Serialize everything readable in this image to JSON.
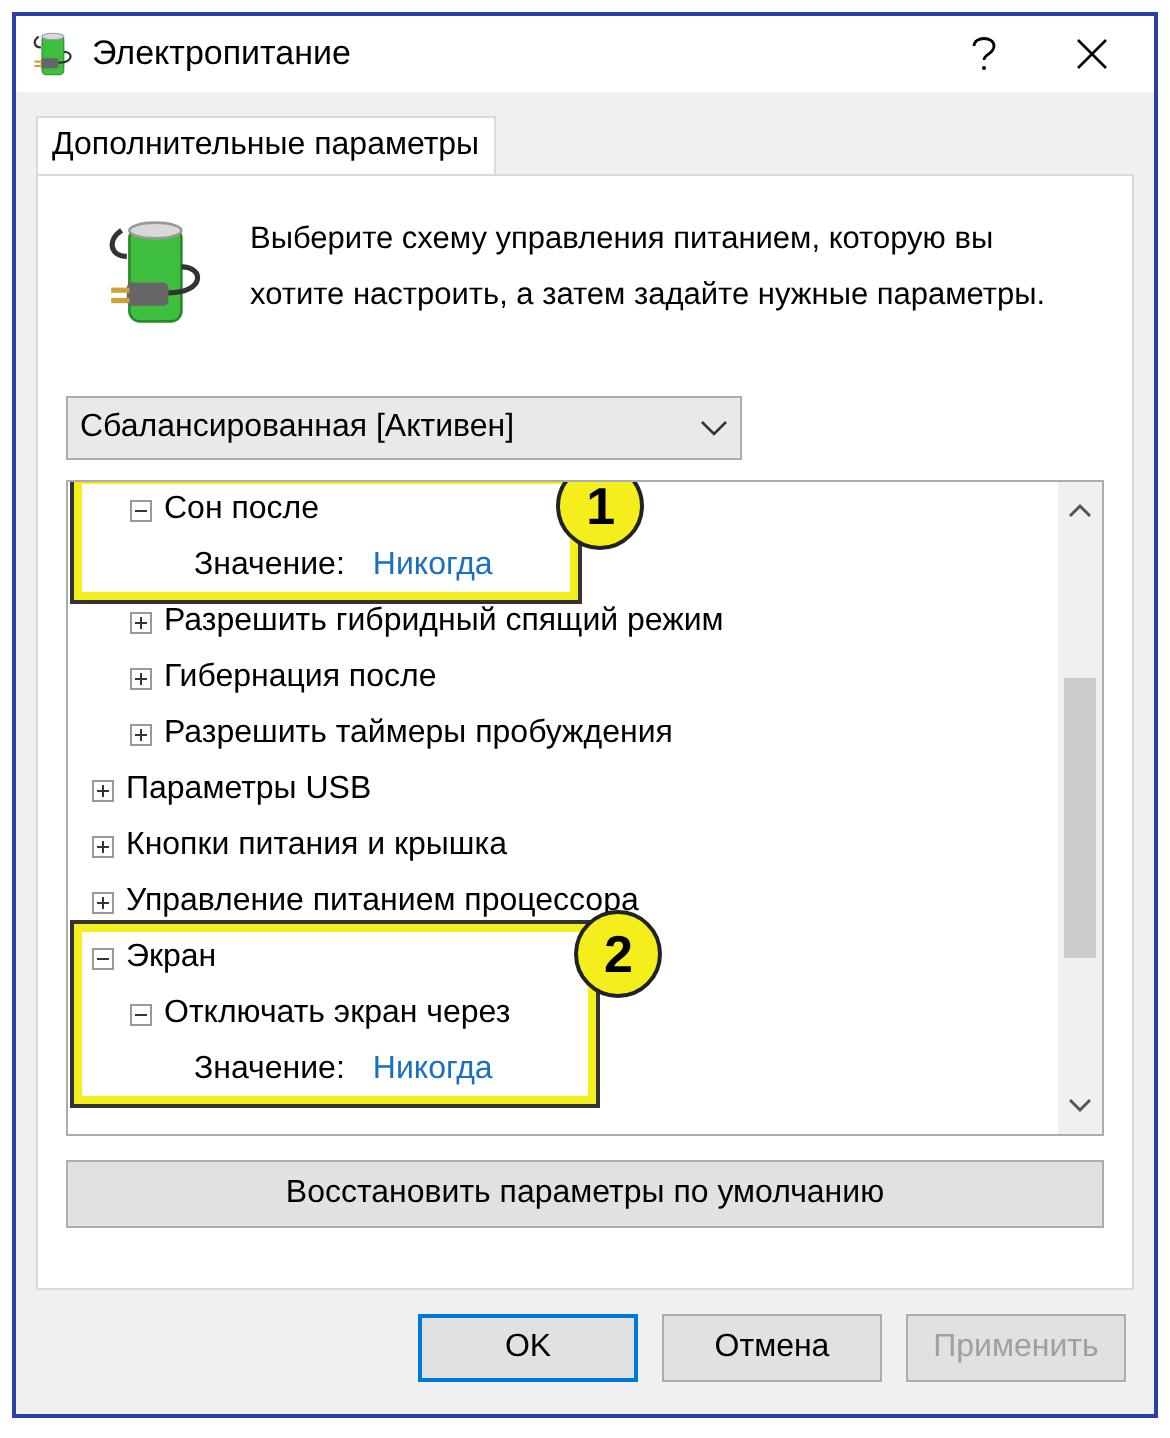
{
  "window": {
    "title": "Электропитание"
  },
  "tabs": [
    {
      "label": "Дополнительные параметры",
      "selected": true
    }
  ],
  "intro": "Выберите схему управления питанием, которую вы хотите настроить, а затем задайте нужные параметры.",
  "plan_dropdown": {
    "value": "Сбалансированная [Активен]"
  },
  "tree": {
    "items": [
      {
        "children": [
          {
            "label": "Сон после",
            "expanded": true,
            "callout": "1",
            "setting": {
              "label": "Значение:",
              "value": "Никогда"
            }
          },
          {
            "label": "Разрешить гибридный спящий режим",
            "expanded": false
          },
          {
            "label": "Гибернация после",
            "expanded": false
          },
          {
            "label": "Разрешить таймеры пробуждения",
            "expanded": false
          }
        ]
      },
      {
        "label": "Параметры USB",
        "expanded": false
      },
      {
        "label": "Кнопки питания и крышка",
        "expanded": false
      },
      {
        "label": "Управление питанием процессора",
        "expanded": false
      },
      {
        "label": "Экран",
        "expanded": true,
        "callout": "2",
        "children": [
          {
            "label": "Отключать экран через",
            "expanded": true,
            "setting": {
              "label": "Значение:",
              "value": "Никогда"
            }
          }
        ]
      }
    ]
  },
  "restore_button": "Восстановить параметры по умолчанию",
  "buttons": [
    {
      "label": "OK",
      "default": true,
      "disabled": false
    },
    {
      "label": "Отмена",
      "default": false,
      "disabled": false
    },
    {
      "label": "Применить",
      "default": false,
      "disabled": true
    }
  ]
}
